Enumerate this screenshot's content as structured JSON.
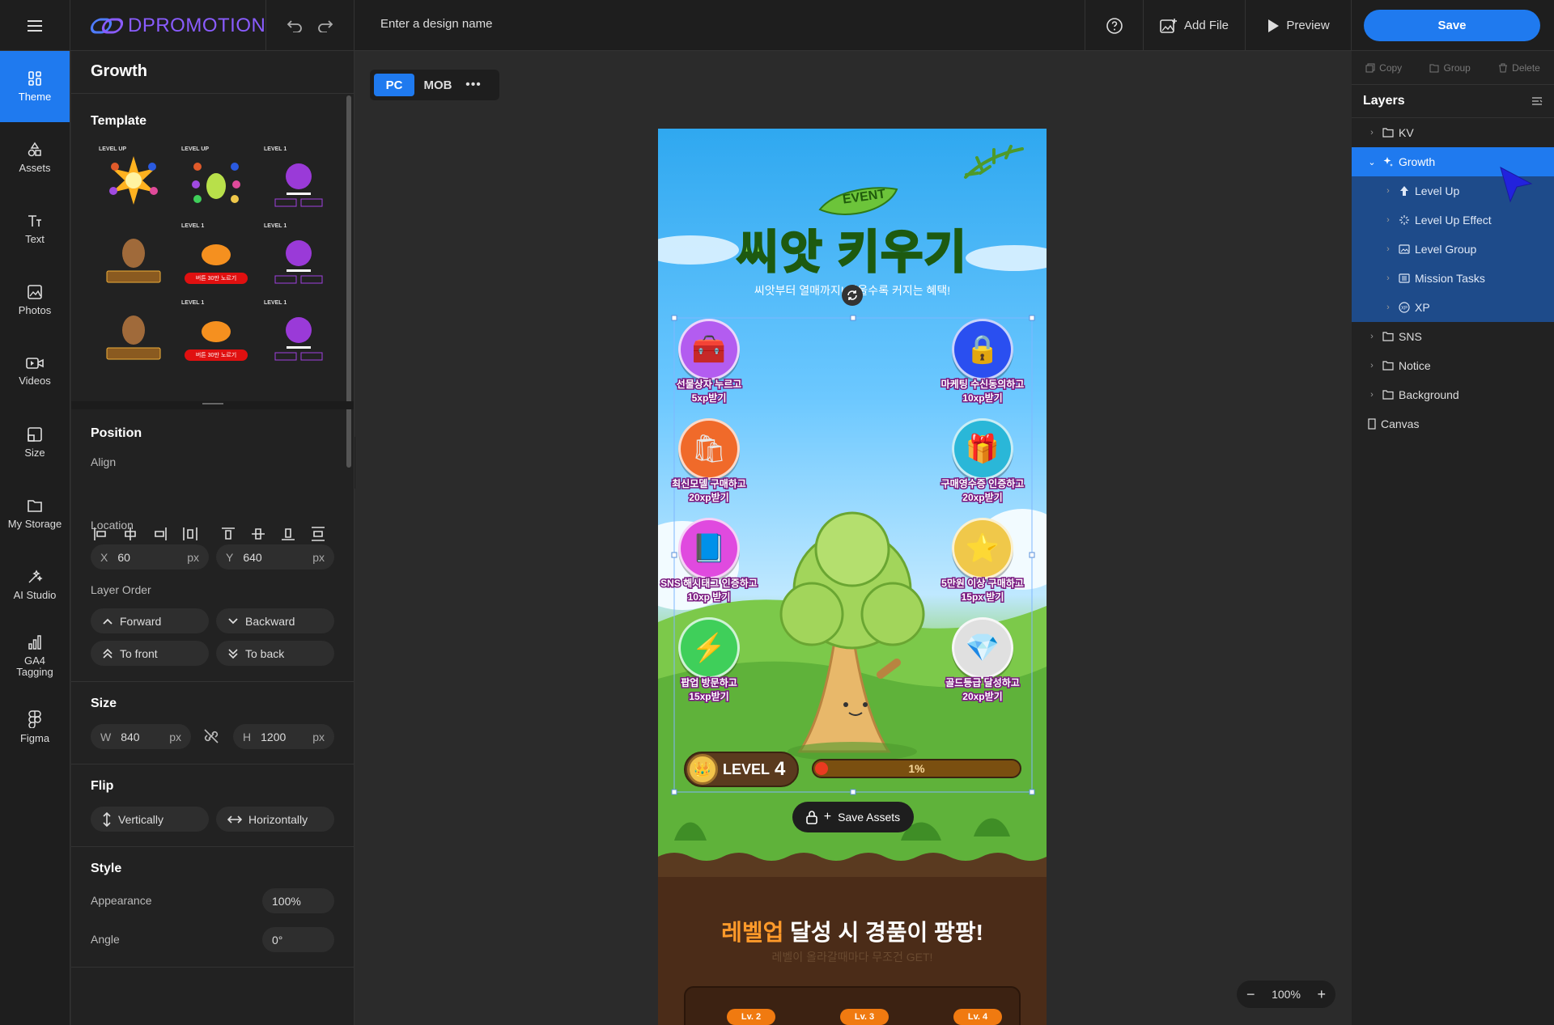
{
  "app": {
    "logo": "DPROMOTION",
    "design_name_placeholder": "Enter a design name"
  },
  "toolbar": {
    "add_file": "Add File",
    "preview": "Preview",
    "save": "Save"
  },
  "nav": [
    {
      "label": "Theme",
      "icon": "theme-icon"
    },
    {
      "label": "Assets",
      "icon": "assets-icon"
    },
    {
      "label": "Text",
      "icon": "text-icon"
    },
    {
      "label": "Photos",
      "icon": "photos-icon"
    },
    {
      "label": "Videos",
      "icon": "videos-icon"
    },
    {
      "label": "Size",
      "icon": "size-icon"
    },
    {
      "label": "My Storage",
      "icon": "storage-icon"
    },
    {
      "label": "AI Studio",
      "icon": "ai-studio-icon"
    },
    {
      "label": "GA4 Tagging",
      "icon": "ga4-icon"
    },
    {
      "label": "Figma",
      "icon": "figma-icon"
    }
  ],
  "panel": {
    "title": "Growth",
    "template_heading": "Template",
    "template_tiles": {
      "level_up": "LEVEL UP",
      "level1": "LEVEL 1",
      "red_btn": "버튼 30만 노르기"
    },
    "position": {
      "heading": "Position",
      "align_label": "Align",
      "location_label": "Location",
      "x_prefix": "X",
      "x": "60",
      "y_prefix": "Y",
      "y": "640",
      "unit": "px",
      "layer_order_label": "Layer Order",
      "forward": "Forward",
      "backward": "Backward",
      "to_front": "To front",
      "to_back": "To back"
    },
    "size": {
      "heading": "Size",
      "w_prefix": "W",
      "w": "840",
      "h_prefix": "H",
      "h": "1200",
      "unit": "px"
    },
    "flip": {
      "heading": "Flip",
      "vertically": "Vertically",
      "horizontally": "Horizontally"
    },
    "style": {
      "heading": "Style",
      "appearance_label": "Appearance",
      "appearance": "100%",
      "angle_label": "Angle",
      "angle": "0°"
    }
  },
  "device": {
    "pc": "PC",
    "mob": "MOB"
  },
  "artboard": {
    "event_badge": "EVENT",
    "title": "씨앗 키우기",
    "subtitle": "씨앗부터 열매까지! 키울수록 커지는 혜택!",
    "missions_left": [
      {
        "line1": "선물상자 누르고",
        "line2": "5xp받기",
        "color": "#b35cf0",
        "emoji": "🧰"
      },
      {
        "line1": "최신모델 구매하고",
        "line2": "20xp받기",
        "color": "#f06a2a",
        "emoji": "🛍"
      },
      {
        "line1": "SNS 해시태그 인증하고",
        "line2": "10xp 받기",
        "color": "#e04adf",
        "emoji": "📘"
      },
      {
        "line1": "팝업 방문하고",
        "line2": "15xp받기",
        "color": "#3fcf5a",
        "emoji": "⚡"
      }
    ],
    "missions_right": [
      {
        "line1": "마케팅 수신동의하고",
        "line2": "10xp받기",
        "color": "#2a4ff0",
        "emoji": "🔒"
      },
      {
        "line1": "구매영수증 인증하고",
        "line2": "20xp받기",
        "color": "#2ab7d8",
        "emoji": "🎁"
      },
      {
        "line1": "5만원 이상 구매하고",
        "line2": "15px 받기",
        "color": "#f0c84a",
        "emoji": "⭐"
      },
      {
        "line1": "골드등급 달성하고",
        "line2": "20xp받기",
        "color": "#e0e0e0",
        "emoji": "💎"
      }
    ],
    "level_label": "LEVEL",
    "level_value": "4",
    "progress_text": "1%",
    "progress": 0.01,
    "save_assets": "Save Assets",
    "reward_title_highlight": "레벨업",
    "reward_title_rest": " 달성 시 경품이 팡팡!",
    "reward_sub": "레벨이 올라갈때마다 무조건 GET!",
    "level_tabs": [
      "Lv. 2",
      "Lv. 3",
      "Lv. 4"
    ]
  },
  "zoom": {
    "value": "100%"
  },
  "right_tools": {
    "copy": "Copy",
    "group": "Group",
    "delete": "Delete"
  },
  "layers": {
    "heading": "Layers",
    "items": [
      {
        "label": "KV",
        "icon": "folder-icon"
      },
      {
        "label": "Growth",
        "icon": "sparkle-icon"
      },
      {
        "label": "Level Up",
        "icon": "level-up-icon"
      },
      {
        "label": "Level Up Effect",
        "icon": "effect-icon"
      },
      {
        "label": "Level Group",
        "icon": "image-icon"
      },
      {
        "label": "Mission Tasks",
        "icon": "list-icon"
      },
      {
        "label": "XP",
        "icon": "xp-icon"
      },
      {
        "label": "SNS",
        "icon": "folder-icon"
      },
      {
        "label": "Notice",
        "icon": "folder-icon"
      },
      {
        "label": "Background",
        "icon": "folder-icon"
      },
      {
        "label": "Canvas",
        "icon": "canvas-icon"
      }
    ]
  }
}
